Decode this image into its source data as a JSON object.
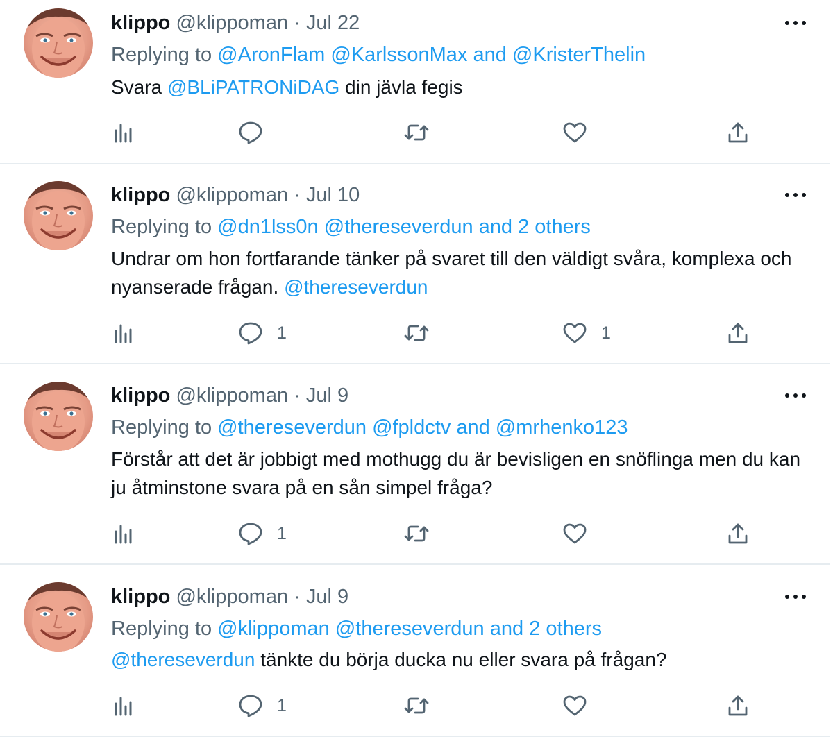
{
  "tweets": [
    {
      "name": "klippo",
      "handle": "@klippoman",
      "separator": "·",
      "date": "Jul 22",
      "replying_prefix": "Replying to",
      "reply_mentions": [
        "@AronFlam",
        "@KarlssonMax"
      ],
      "reply_tail": "and @KristerThelin",
      "body": [
        {
          "text": "Svara ",
          "link": false
        },
        {
          "text": "@BLiPATRONiDAG",
          "link": true
        },
        {
          "text": " din jävla fegis",
          "link": false
        }
      ],
      "reply_count": "",
      "like_count": ""
    },
    {
      "name": "klippo",
      "handle": "@klippoman",
      "separator": "·",
      "date": "Jul 10",
      "replying_prefix": "Replying to",
      "reply_mentions": [
        "@dn1lss0n",
        "@thereseverdun"
      ],
      "reply_tail": "and 2 others",
      "body": [
        {
          "text": "Undrar om hon fortfarande tänker på svaret till den väldigt svåra, komplexa och nyanserade frågan. ",
          "link": false
        },
        {
          "text": "@thereseverdun",
          "link": true
        }
      ],
      "reply_count": "1",
      "like_count": "1"
    },
    {
      "name": "klippo",
      "handle": "@klippoman",
      "separator": "·",
      "date": "Jul 9",
      "replying_prefix": "Replying to",
      "reply_mentions": [
        "@thereseverdun",
        "@fpldctv"
      ],
      "reply_tail": "and @mrhenko123",
      "body": [
        {
          "text": "Förstår att det är jobbigt med mothugg du är bevisligen en snöflinga men du kan ju åtminstone svara på en sån simpel fråga?",
          "link": false
        }
      ],
      "reply_count": "1",
      "like_count": ""
    },
    {
      "name": "klippo",
      "handle": "@klippoman",
      "separator": "·",
      "date": "Jul 9",
      "replying_prefix": "Replying to",
      "reply_mentions": [
        "@klippoman",
        "@thereseverdun"
      ],
      "reply_tail": "and 2 others",
      "body": [
        {
          "text": "@thereseverdun",
          "link": true
        },
        {
          "text": " tänkte du börja ducka nu eller svara på frågan?",
          "link": false
        }
      ],
      "reply_count": "1",
      "like_count": ""
    }
  ],
  "icons": {
    "more": "more-options-icon",
    "analytics": "analytics-icon",
    "reply": "reply-icon",
    "retweet": "retweet-icon",
    "like": "like-icon",
    "share": "share-icon"
  },
  "colors": {
    "text": "#0f1419",
    "secondary": "#536471",
    "link": "#1d9bf0",
    "divider": "#e6ecf0"
  }
}
